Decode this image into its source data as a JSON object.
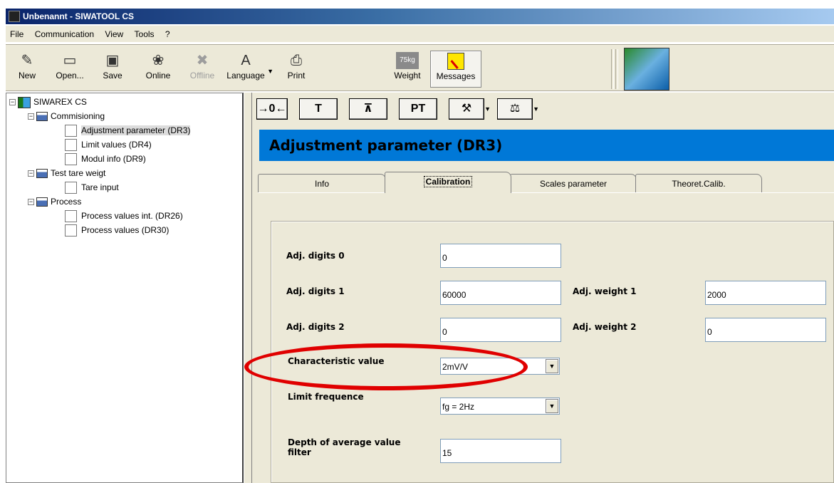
{
  "window": {
    "title": "Unbenannt - SIWATOOL CS"
  },
  "menu": [
    "File",
    "Communication",
    "View",
    "Tools",
    "?"
  ],
  "toolbar": {
    "new": "New",
    "open": "Open...",
    "save": "Save",
    "online": "Online",
    "offline": "Offline",
    "language": "Language",
    "print": "Print",
    "weight": "Weight",
    "weight_badge": "75kg",
    "messages": "Messages"
  },
  "tree": {
    "root": "SIWAREX CS",
    "groups": [
      {
        "label": "Commisioning",
        "items": [
          "Adjustment parameter (DR3)",
          "Limit values (DR4)",
          "Modul info (DR9)"
        ]
      },
      {
        "label": "Test tare weigt",
        "items": [
          "Tare input"
        ]
      },
      {
        "label": "Process",
        "items": [
          "Process values int. (DR26)",
          "Process values (DR30)"
        ]
      }
    ],
    "selected": "Adjustment parameter (DR3)"
  },
  "commands": {
    "zero": "→0←",
    "tare": "T",
    "clear_tare": "⊼",
    "preset_tare": "PT"
  },
  "page": {
    "title": "Adjustment parameter (DR3)"
  },
  "tabs": [
    "Info",
    "Calibration",
    "Scales parameter",
    "Theoret.Calib."
  ],
  "active_tab": "Calibration",
  "form": {
    "adj_digits_0": {
      "label": "Adj. digits 0",
      "value": "0"
    },
    "adj_digits_1": {
      "label": "Adj. digits 1",
      "value": "60000"
    },
    "adj_digits_2": {
      "label": "Adj. digits 2",
      "value": "0"
    },
    "adj_weight_1": {
      "label": "Adj. weight 1",
      "value": "2000"
    },
    "adj_weight_2": {
      "label": "Adj. weight 2",
      "value": "0"
    },
    "characteristic_value": {
      "label": "Characteristic value",
      "value": "2mV/V"
    },
    "limit_frequence": {
      "label": "Limit frequence",
      "value": "fg = 2Hz"
    },
    "depth_filter": {
      "label_line1": "Depth of average value",
      "label_line2": "filter",
      "value": "15"
    }
  },
  "colors": {
    "header_band": "#0078d7",
    "annotation": "#e00000",
    "title_bar": "#0a246a"
  }
}
